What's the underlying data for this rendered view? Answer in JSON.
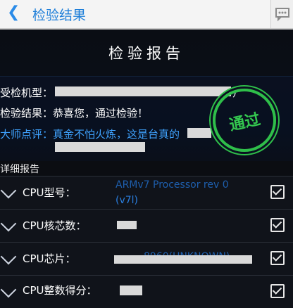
{
  "topbar": {
    "back_glyph": "❮",
    "title": "检验结果",
    "share_icon": "share-icon"
  },
  "report": {
    "title": "检验报告"
  },
  "summary": {
    "model_label": "受检机型：",
    "model_tail": "）",
    "result_text": "检验结果：恭喜您，通过检验！",
    "comment_text": "大师点评：真金不怕火炼，这是台真的",
    "stamp_text": "通过"
  },
  "details": {
    "label": "详细报告",
    "rows": [
      {
        "label": "CPU型号：",
        "value": "ARMv7 Processor rev 0",
        "value2": "(v7l)"
      },
      {
        "label": "CPU核芯数：",
        "value": ""
      },
      {
        "label": "CPU芯片：",
        "value": "8960(UNKNOWN)"
      },
      {
        "label": "CPU整数得分：",
        "value": ""
      }
    ]
  },
  "colors": {
    "accent": "#2a8be8",
    "stamp": "#2fbf4a",
    "highlight": "#3fa3ff"
  }
}
